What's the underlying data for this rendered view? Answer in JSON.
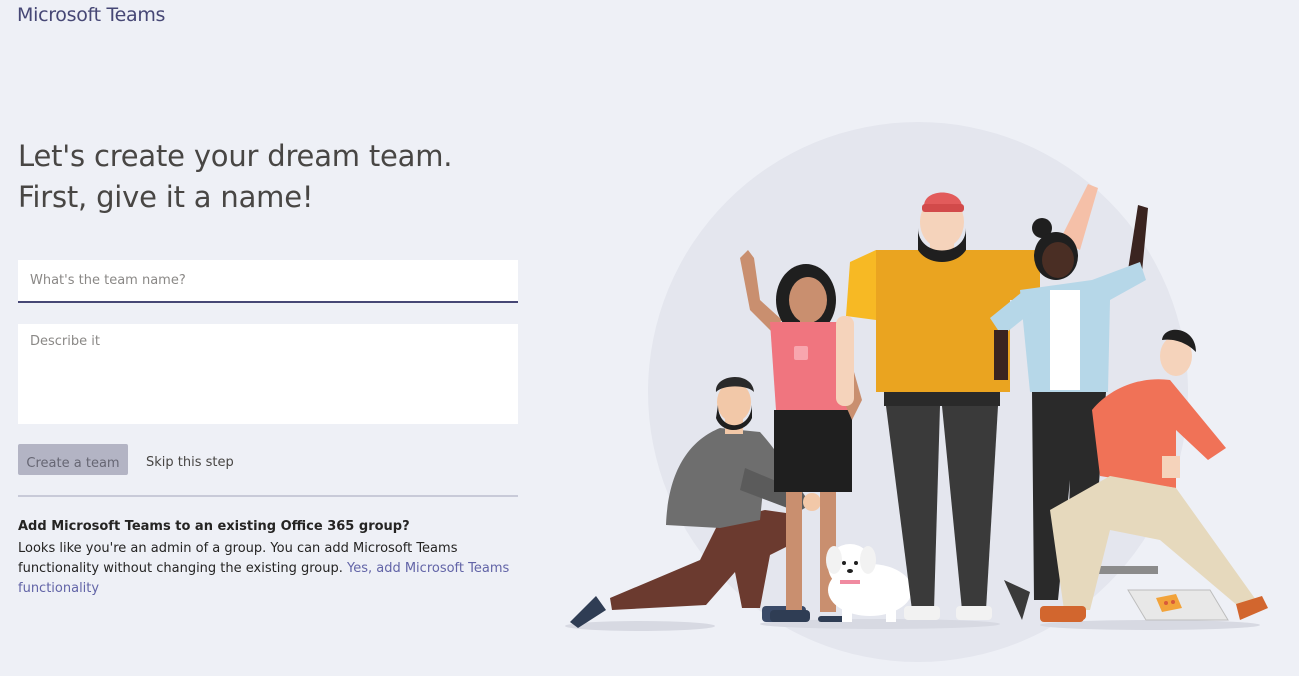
{
  "app": {
    "brand": "Microsoft Teams"
  },
  "create": {
    "headline": "Let's create your dream team. First, give it a name!",
    "name_placeholder": "What's the team name?",
    "description_placeholder": "Describe it",
    "create_button": "Create a team",
    "skip_link": "Skip this step"
  },
  "group": {
    "title": "Add Microsoft Teams to an existing Office 365 group?",
    "body": "Looks like you're an admin of a group. You can add Microsoft Teams functionality without changing the existing group.",
    "link": "Yes, add Microsoft Teams functionality"
  },
  "colors": {
    "background": "#eef0f6",
    "brand": "#464775",
    "link": "#6264a7",
    "button_disabled": "#b3b4c4"
  }
}
